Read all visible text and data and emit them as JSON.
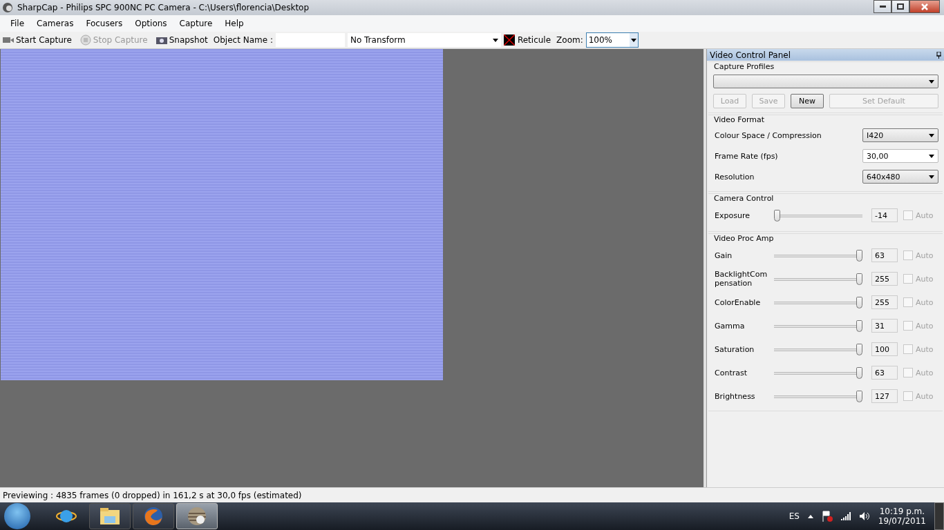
{
  "window": {
    "title": "SharpCap - Philips SPC 900NC PC Camera - C:\\Users\\florencia\\Desktop"
  },
  "menu": [
    "File",
    "Cameras",
    "Focusers",
    "Options",
    "Capture",
    "Help"
  ],
  "toolbar": {
    "buttons": [
      {
        "label": "Start Capture",
        "disabled": false
      },
      {
        "label": "Stop Capture",
        "disabled": true
      },
      {
        "label": "Snapshot",
        "disabled": false
      }
    ],
    "object_name_label": "Object Name :",
    "transform": "No Transform",
    "reticule": "Reticule",
    "zoom_label": "Zoom:",
    "zoom": "100%"
  },
  "panel": {
    "title": "Video Control Panel",
    "capture_profiles": {
      "title": "Capture Profiles",
      "buttons": [
        {
          "label": "Load",
          "disabled": true
        },
        {
          "label": "Save",
          "disabled": true
        },
        {
          "label": "New",
          "disabled": false
        },
        {
          "label": "Set Default",
          "disabled": true
        }
      ]
    },
    "video_format": {
      "title": "Video Format",
      "fields": [
        {
          "label": "Colour Space / Compression",
          "value": "I420",
          "editable": false
        },
        {
          "label": "Frame Rate (fps)",
          "value": "30,00",
          "editable": true
        },
        {
          "label": "Resolution",
          "value": "640x480",
          "editable": false
        }
      ]
    },
    "camera_control": {
      "title": "Camera Control",
      "controls": [
        {
          "label": "Exposure",
          "level": 0.0,
          "value": "-14",
          "auto_label": "Auto",
          "checked": false
        }
      ]
    },
    "video_proc_amp": {
      "title": "Video Proc Amp",
      "controls": [
        {
          "label": "Gain",
          "level": 1.0,
          "value": "63",
          "auto_label": "Auto",
          "checked": false
        },
        {
          "label": "BacklightCom pensation",
          "level": 1.0,
          "value": "255",
          "auto_label": "Auto",
          "checked": false
        },
        {
          "label": "ColorEnable",
          "level": 1.0,
          "value": "255",
          "auto_label": "Auto",
          "checked": false
        },
        {
          "label": "Gamma",
          "level": 1.0,
          "value": "31",
          "auto_label": "Auto",
          "checked": false
        },
        {
          "label": "Saturation",
          "level": 1.0,
          "value": "100",
          "auto_label": "Auto",
          "checked": false
        },
        {
          "label": "Contrast",
          "level": 1.0,
          "value": "63",
          "auto_label": "Auto",
          "checked": false
        },
        {
          "label": "Brightness",
          "level": 1.0,
          "value": "127",
          "auto_label": "Auto",
          "checked": false
        }
      ]
    }
  },
  "status_bar": "Previewing : 4835 frames (0 dropped) in 161,2 s at 30,0 fps (estimated)",
  "taskbar": {
    "apps": [
      {
        "kind": "ie",
        "running": false,
        "selected": false
      },
      {
        "kind": "folder",
        "running": true,
        "selected": false
      },
      {
        "kind": "firefox",
        "running": true,
        "selected": false
      },
      {
        "kind": "sharpcap",
        "running": true,
        "selected": true
      }
    ],
    "language": "ES",
    "time": "10:19 p.m.",
    "date": "19/07/2011"
  }
}
